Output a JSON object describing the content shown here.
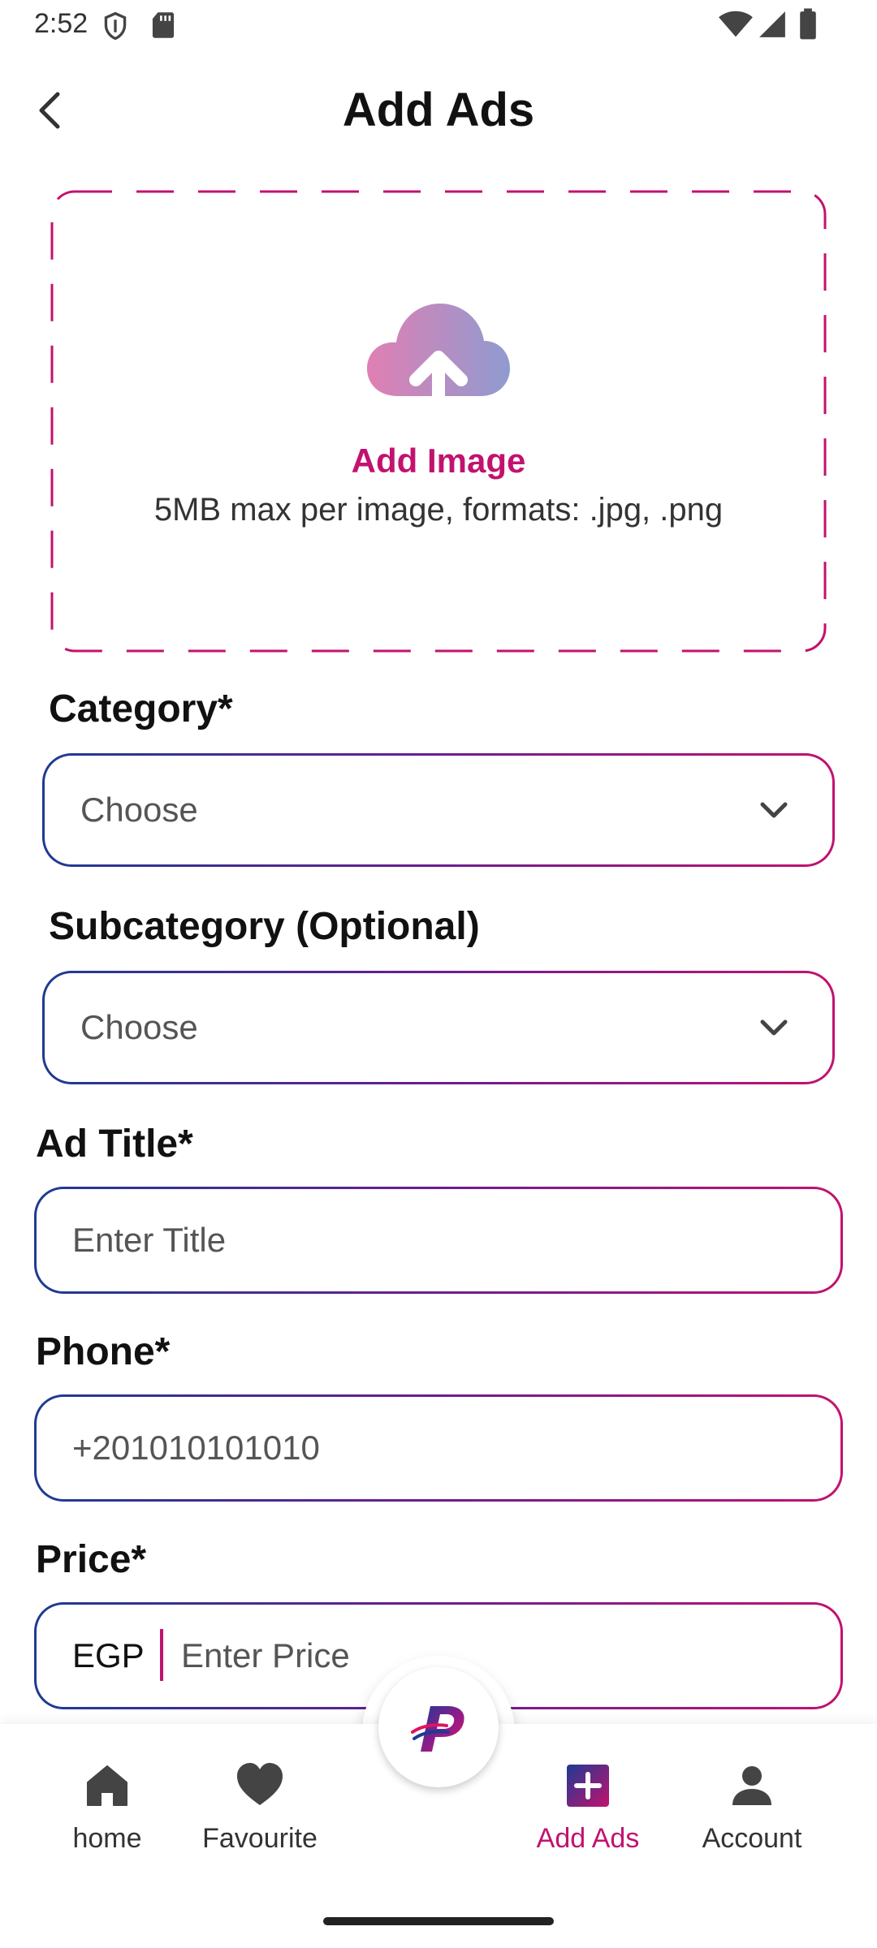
{
  "status_bar": {
    "time": "2:52"
  },
  "header": {
    "title": "Add Ads"
  },
  "upload": {
    "title": "Add Image",
    "subtitle": "5MB max per image, formats: .jpg, .png"
  },
  "form": {
    "category": {
      "label": "Category*",
      "value": "Choose"
    },
    "subcategory": {
      "label": "Subcategory (Optional)",
      "value": "Choose"
    },
    "ad_title": {
      "label": "Ad Title*",
      "placeholder": "Enter Title"
    },
    "phone": {
      "label": "Phone*",
      "value": "+201010101010"
    },
    "price": {
      "label": "Price*",
      "currency": "EGP",
      "placeholder": "Enter Price"
    }
  },
  "bottom_nav": {
    "items": [
      {
        "label": "home",
        "icon": "home-icon"
      },
      {
        "label": "Favourite",
        "icon": "heart-icon"
      },
      {
        "label": "Add Ads",
        "icon": "add-square-icon",
        "active": true
      },
      {
        "label": "Account",
        "icon": "person-icon"
      }
    ]
  },
  "colors": {
    "accent": "#c2126f",
    "gradient_start": "#1f3a93",
    "gradient_end": "#c2126f"
  }
}
